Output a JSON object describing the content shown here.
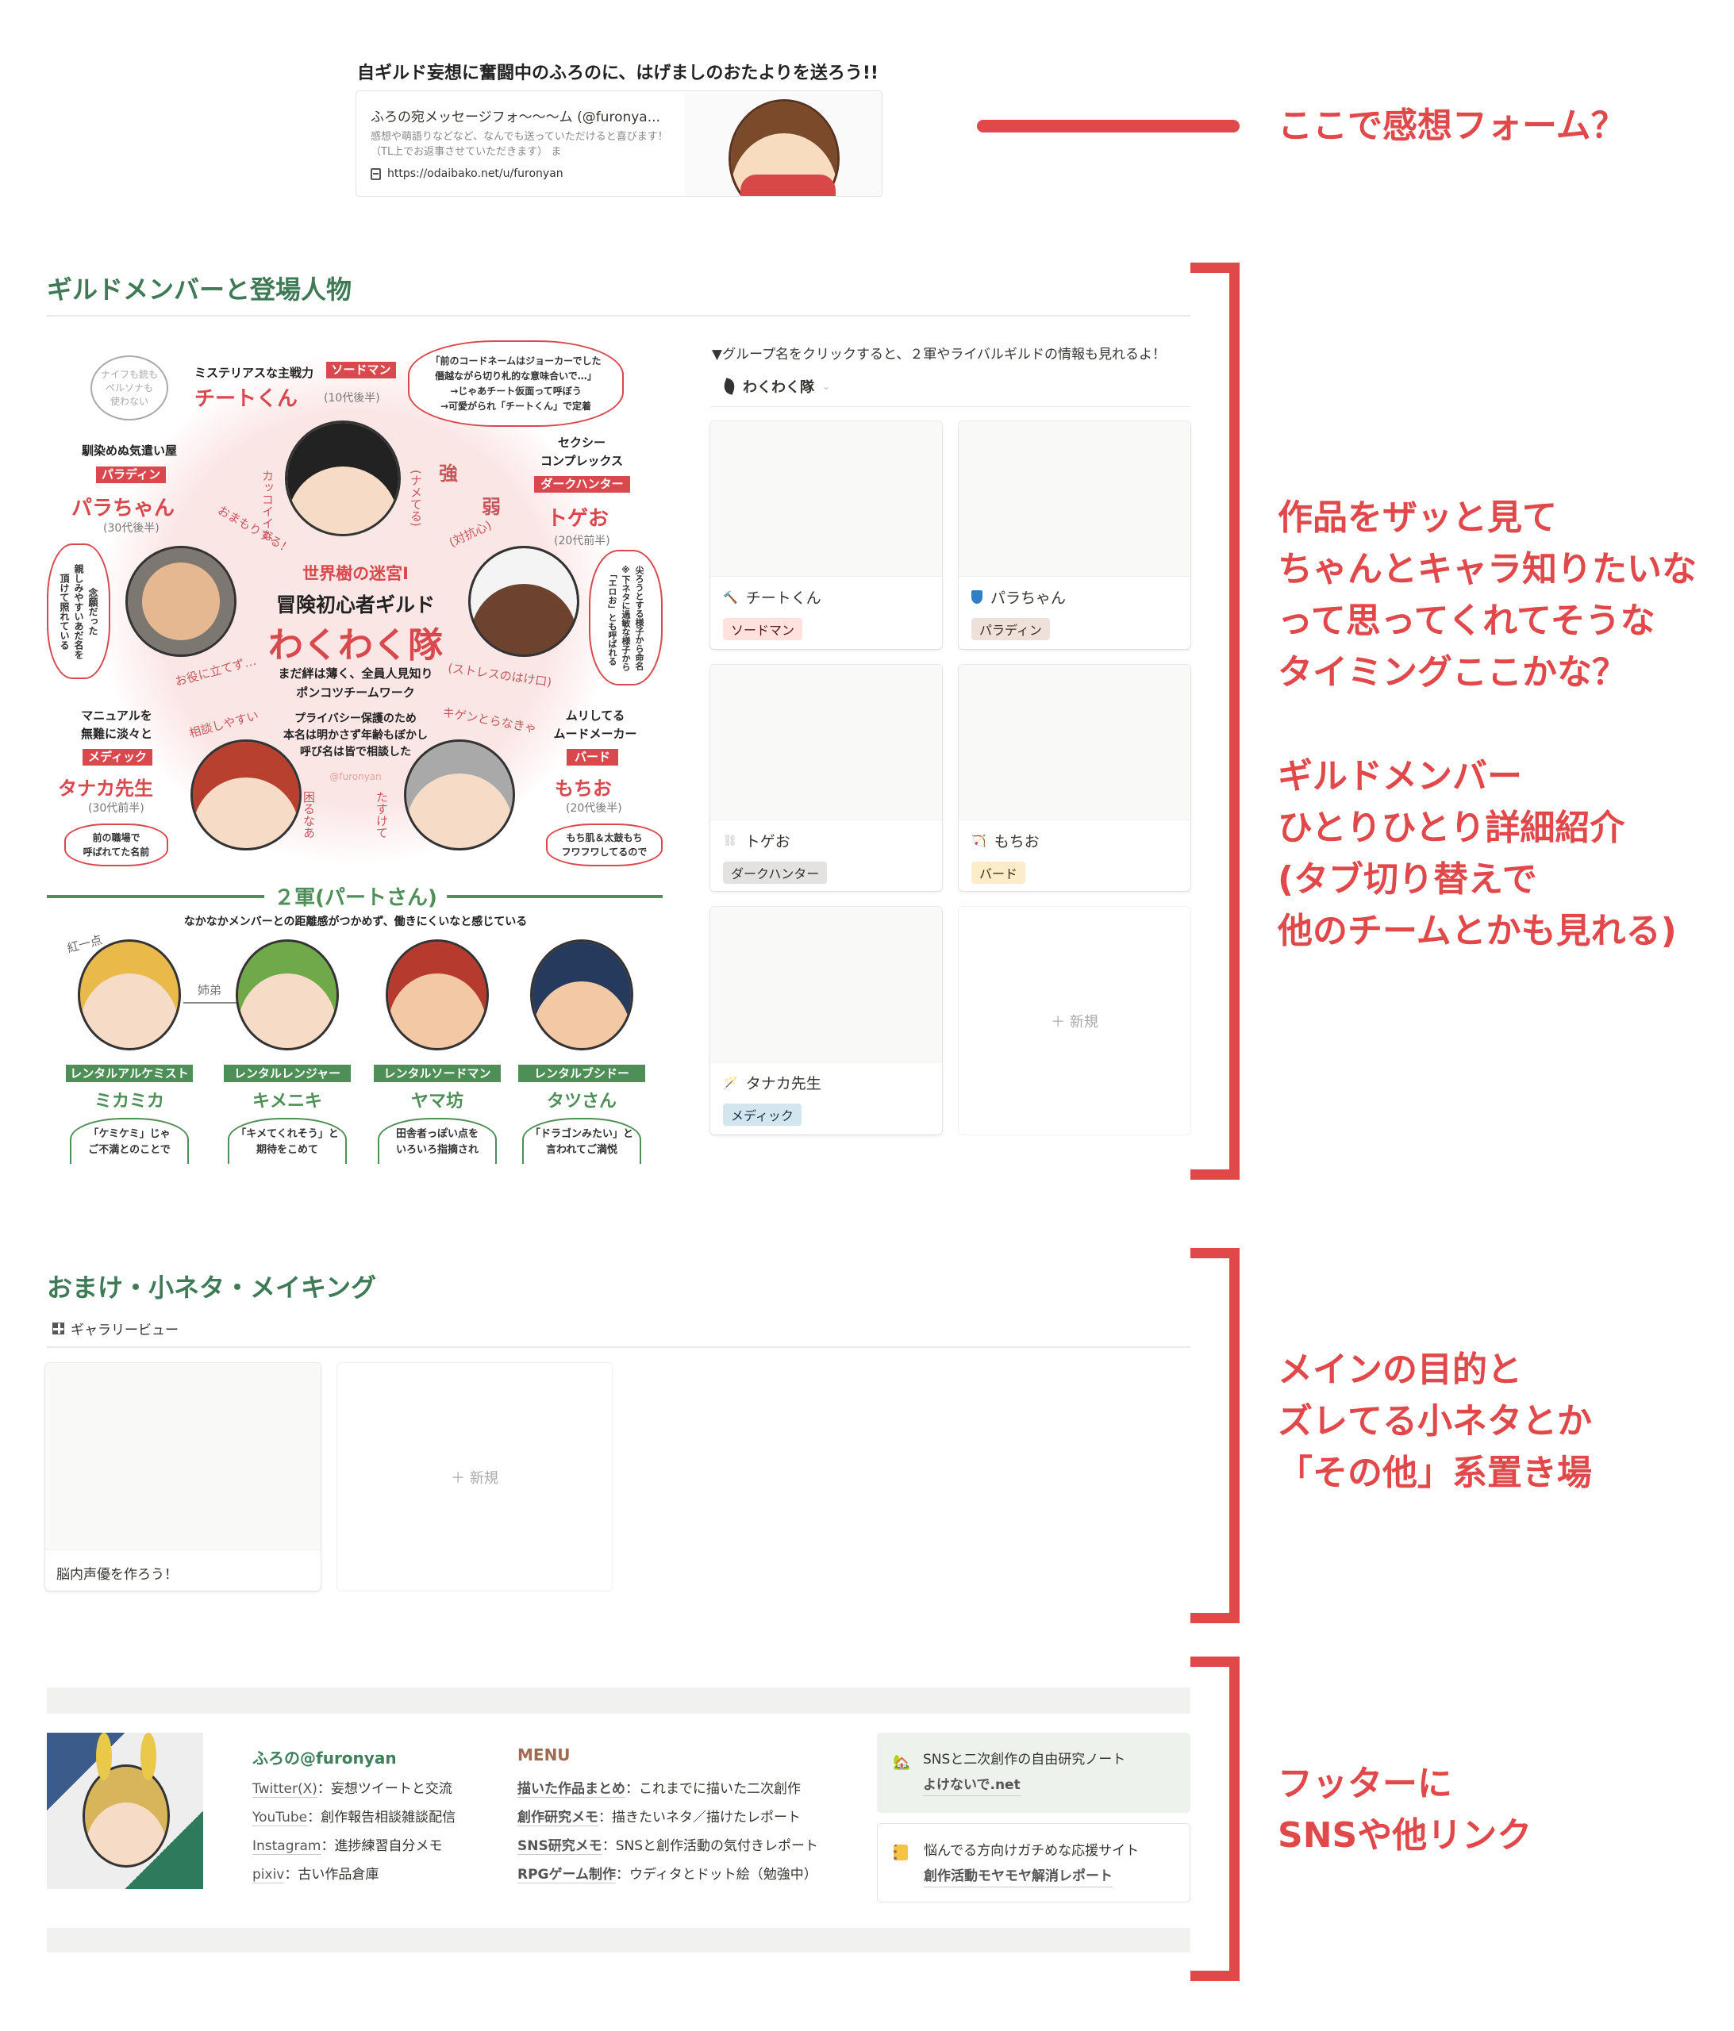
{
  "top": {
    "heading": "自ギルド妄想に奮闘中のふろのに、はげましのおたよりを送ろう!!",
    "bookmark": {
      "title": "ふろの宛メッセージフォ〜〜〜ム (@furonya...",
      "description": "感想や萌語りなどなど、なんでも送っていただけると喜びます！（TL上でお返事させていただきます） ま",
      "url": "https://odaibako.net/u/furonyan",
      "icon": "page-icon"
    }
  },
  "annotations": {
    "form": "ここで感想フォーム？",
    "members_1": [
      "作品をザッと見て",
      "ちゃんとキャラ知りたいな",
      "って思ってくれてそうな",
      "タイミングここかな？"
    ],
    "members_2": [
      "ギルドメンバー",
      "ひとりひとり詳細紹介",
      "(タブ切り替えで",
      "他のチームとかも見れる)"
    ],
    "extras": [
      "メインの目的と",
      "ズレてる小ネタとか",
      "「その他」系置き場"
    ],
    "footer": [
      "フッターに",
      "SNSや他リンク"
    ],
    "color": "#e0484a"
  },
  "members_section": {
    "heading": "ギルドメンバーと登場人物",
    "note": "▼グループ名をクリックすると、２軍やライバルギルドの情報も見れるよ！",
    "group_tab": {
      "label": "わくわく隊",
      "icon": "leaf-icon"
    },
    "cards": [
      {
        "name": "チートくん",
        "icon": "hammer-icon",
        "tag": "ソードマン",
        "tag_bg": "#ffe2dd",
        "tag_fg": "#5d1715"
      },
      {
        "name": "パラちゃん",
        "icon": "shield-icon",
        "tag": "パラディン",
        "tag_bg": "#eee0da",
        "tag_fg": "#442a1e"
      },
      {
        "name": "トゲお",
        "icon": "chains-icon",
        "tag": "ダークハンター",
        "tag_bg": "#e3e2e0",
        "tag_fg": "#32302c"
      },
      {
        "name": "もちお",
        "icon": "bow-icon",
        "tag": "バード",
        "tag_bg": "#fdecc8",
        "tag_fg": "#402c1b"
      },
      {
        "name": "タナカ先生",
        "icon": "wand-icon",
        "tag": "メディック",
        "tag_bg": "#d3e5ef",
        "tag_fg": "#183347"
      }
    ],
    "new_label": "＋ 新規"
  },
  "illustration": {
    "title1": "世界樹の迷宮Ⅰ",
    "title2": "冒険初心者ギルド",
    "title3": "わくわく隊",
    "desc1": "まだ絆は薄く、全員人見知り",
    "desc2": "ポンコツチームワーク",
    "privacy": [
      "プライバシー保護のため",
      "本名は明かさず年齢もぼかし",
      "呼び名は皆で相談した"
    ],
    "credit": "@furonyan",
    "cheat": {
      "caption": "ミステリアスな主戦力",
      "job": "ソードマン",
      "name": "チートくん",
      "age": "(10代後半)",
      "aside": "ナイフも銃も\nペルソナも\n使わない",
      "bubble": "「前のコードネームはジョーカーでした\n僭越ながら切り札的な意味合いで…」\n→じゃあチート仮面って呼ぼう\n→可愛がられ「チートくん」で定着"
    },
    "para": {
      "caption": "馴染めぬ気遣い屋",
      "job": "パラディン",
      "name": "パラちゃん",
      "age": "(30代後半)",
      "bubble": "念願だった\n親しみやすいあだ名を\n頂けて照れている"
    },
    "toge": {
      "caption1": "セクシー",
      "caption2": "コンプレックス",
      "job": "ダークハンター",
      "name": "トゲお",
      "age": "(20代前半)",
      "bubble": "尖ろうとする様子から命名\n※下ネタに過敏な様子から\n「エロお」とも呼ばれる"
    },
    "tanaka": {
      "caption1": "マニュアルを",
      "caption2": "無難に淡々と",
      "job": "メディック",
      "name": "タナカ先生",
      "age": "(30代前半)",
      "bubble": "前の職場で\n呼ばれてた名前"
    },
    "mochi": {
      "caption1": "ムリしてる",
      "caption2": "ムードメーカー",
      "job": "バード",
      "name": "もちお",
      "age": "(20代後半)",
      "bubble": "もち肌＆太鼓もち\nフワフワしてるので"
    },
    "relations": [
      "カッコイイな",
      "おまもりする！",
      "(ナメてる)",
      "強",
      "弱",
      "(対抗心)",
      "(ストレスのはけ口)",
      "キゲンとらなきゃ",
      "お役に立てず…",
      "相談しやすい",
      "困るなあ",
      "たすけて"
    ],
    "second": {
      "heading": "２軍(パートさん)",
      "subtitle": "なかなかメンバーとの距離感がつかめず、働きにくいなと感じている",
      "note_red": "紅一点",
      "note_siblings": "姉弟",
      "members": [
        {
          "job": "レンタルアルケミスト",
          "name": "ミカミカ",
          "bubble": "「ケミケミ」じゃ\nご不満とのことで"
        },
        {
          "job": "レンタルレンジャー",
          "name": "キメニキ",
          "bubble": "「キメてくれそう」と\n期待をこめて"
        },
        {
          "job": "レンタルソードマン",
          "name": "ヤマ坊",
          "bubble": "田舎者っぽい点を\nいろいろ指摘され"
        },
        {
          "job": "レンタルブシドー",
          "name": "タツさん",
          "bubble": "「ドラゴンみたい」と\n言われてご満悦"
        }
      ]
    }
  },
  "extras_section": {
    "heading": "おまけ・小ネタ・メイキング",
    "view_label": "ギャラリービュー",
    "cards": [
      {
        "name": "脳内声優を作ろう！"
      }
    ],
    "new_label": "＋ 新規"
  },
  "footer": {
    "profile_name": "ふろの@furonyan",
    "sns": [
      {
        "link": "Twitter(X)",
        "desc": "：妄想ツイートと交流"
      },
      {
        "link": "YouTube",
        "desc": "：創作報告相談雑談配信"
      },
      {
        "link": "Instagram",
        "desc": "：進捗練習自分メモ"
      },
      {
        "link": "pixiv",
        "desc": "：古い作品倉庫"
      }
    ],
    "menu_title": "MENU",
    "menu": [
      {
        "link": "描いた作品まとめ",
        "desc": "：これまでに描いた二次創作"
      },
      {
        "link": "創作研究メモ",
        "desc": "：描きたいネタ／描けたレポート"
      },
      {
        "link": "SNS研究メモ",
        "desc": "：SNSと創作活動の気付きレポート"
      },
      {
        "link": "RPGゲーム制作",
        "desc": "：ウディタとドット絵（勉強中）"
      }
    ],
    "callouts": [
      {
        "icon": "house-icon",
        "line1": "SNSと二次創作の自由研究ノート",
        "link": "よけないで.net"
      },
      {
        "icon": "notebook-icon",
        "line1": "悩んでる方向けガチめな応援サイト",
        "link": "創作活動モヤモヤ解消レポート"
      }
    ]
  }
}
